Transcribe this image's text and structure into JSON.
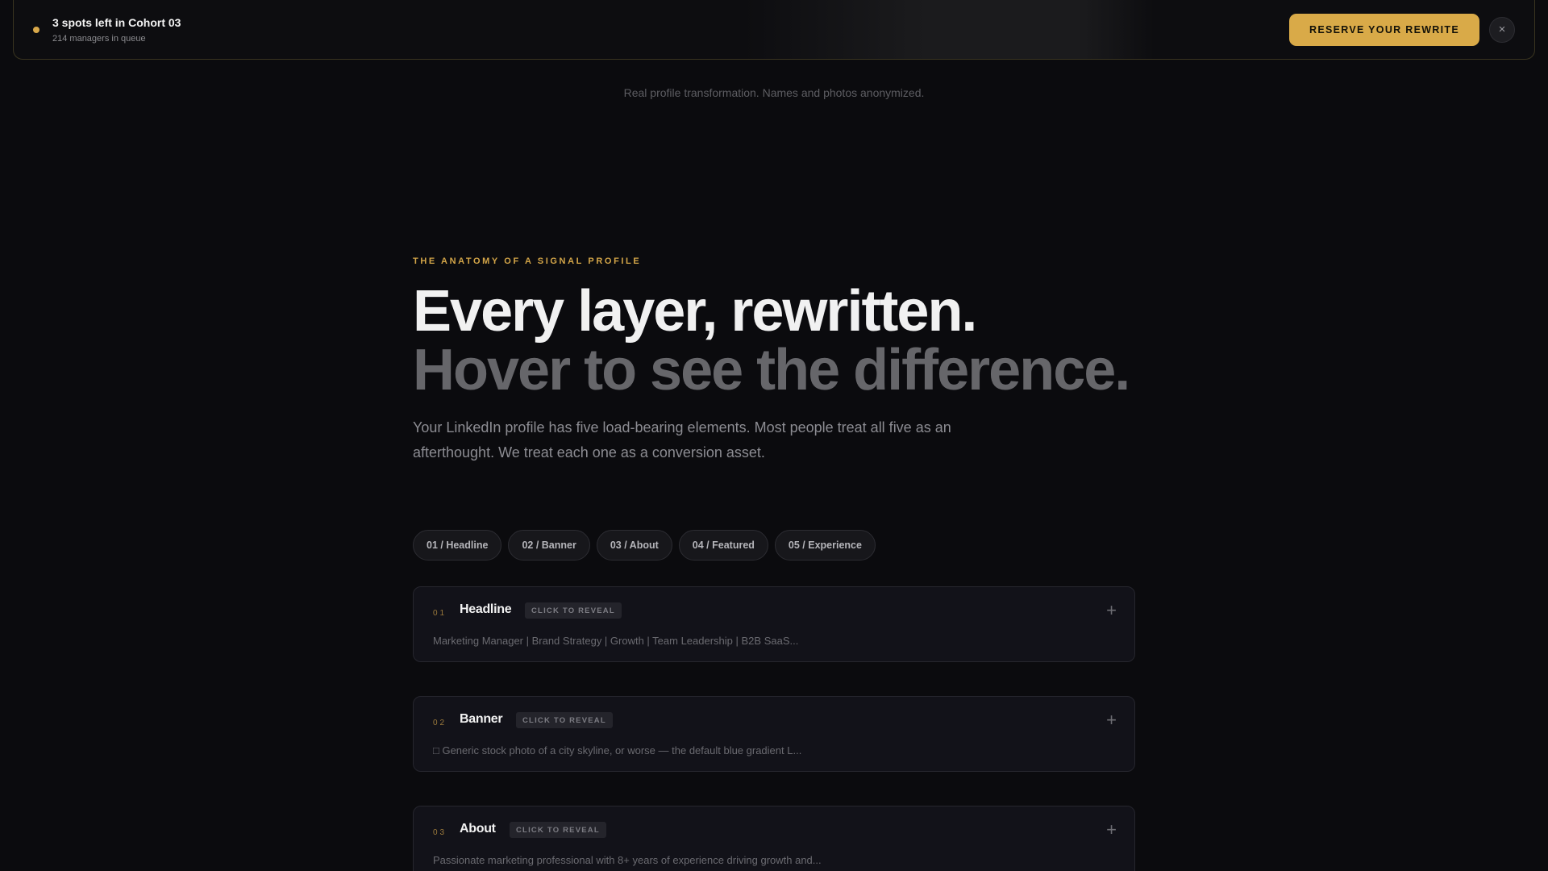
{
  "topbar": {
    "title": "3 spots left in Cohort 03",
    "subtitle": "214 managers in queue",
    "cta_label": "RESERVE YOUR REWRITE",
    "close_label": "×",
    "accent_color": "#d9aa48"
  },
  "caption": "Real profile transformation. Names and photos anonymized.",
  "section": {
    "eyebrow": "THE ANATOMY OF A SIGNAL PROFILE",
    "headline_line1": "Every layer, rewritten.",
    "headline_line2": "Hover to see the difference.",
    "lead": "Your LinkedIn profile has five load-bearing elements. Most people treat all five as an afterthought. We treat each one as a conversion asset."
  },
  "tabs": [
    {
      "label": "01 / Headline"
    },
    {
      "label": "02 / Banner"
    },
    {
      "label": "03 / About"
    },
    {
      "label": "04 / Featured"
    },
    {
      "label": "05 / Experience"
    }
  ],
  "cards": [
    {
      "num": "01",
      "title": "Headline",
      "badge": "CLICK TO REVEAL",
      "toggle": "+",
      "preview": "Marketing Manager | Brand Strategy | Growth | Team Leadership | B2B SaaS..."
    },
    {
      "num": "02",
      "title": "Banner",
      "badge": "CLICK TO REVEAL",
      "toggle": "+",
      "preview": "□ Generic stock photo of a city skyline, or worse — the default blue gradient L..."
    },
    {
      "num": "03",
      "title": "About",
      "badge": "CLICK TO REVEAL",
      "toggle": "+",
      "preview": "Passionate marketing professional with 8+ years of experience driving growth and..."
    }
  ]
}
